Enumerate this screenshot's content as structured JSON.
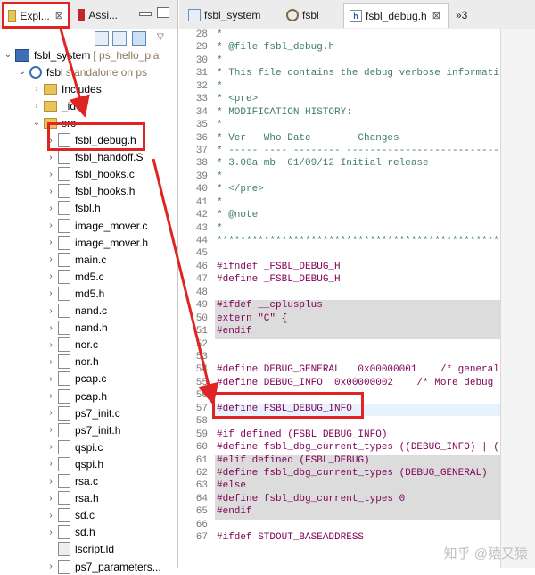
{
  "explorer": {
    "tabs": [
      {
        "label": "Expl...",
        "close": "⊠"
      },
      {
        "label": "Assi..."
      }
    ],
    "toolbar_icons": [
      "collapse-all-icon",
      "link-editor-icon",
      "filter-icon",
      "view-menu-icon"
    ],
    "tree": [
      {
        "label": "fsbl_system",
        "desc": "[ ps_hello_pla",
        "level": 0,
        "expanded": true,
        "icon": "project"
      },
      {
        "label": "fsbl",
        "desc": "standalone on ps",
        "level": 1,
        "expanded": true,
        "icon": "gear"
      },
      {
        "label": "Includes",
        "level": 2,
        "expanded": false,
        "icon": "folder"
      },
      {
        "label": "_ide",
        "level": 2,
        "expanded": false,
        "icon": "folder"
      },
      {
        "label": "src",
        "level": 2,
        "expanded": true,
        "icon": "folder"
      },
      {
        "label": "fsbl_debug.h",
        "level": 3,
        "icon": "h"
      },
      {
        "label": "fsbl_handoff.S",
        "level": 3,
        "icon": "S"
      },
      {
        "label": "fsbl_hooks.c",
        "level": 3,
        "icon": "c"
      },
      {
        "label": "fsbl_hooks.h",
        "level": 3,
        "icon": "h"
      },
      {
        "label": "fsbl.h",
        "level": 3,
        "icon": "h"
      },
      {
        "label": "image_mover.c",
        "level": 3,
        "icon": "c"
      },
      {
        "label": "image_mover.h",
        "level": 3,
        "icon": "h"
      },
      {
        "label": "main.c",
        "level": 3,
        "icon": "c"
      },
      {
        "label": "md5.c",
        "level": 3,
        "icon": "c"
      },
      {
        "label": "md5.h",
        "level": 3,
        "icon": "h"
      },
      {
        "label": "nand.c",
        "level": 3,
        "icon": "c"
      },
      {
        "label": "nand.h",
        "level": 3,
        "icon": "h"
      },
      {
        "label": "nor.c",
        "level": 3,
        "icon": "c"
      },
      {
        "label": "nor.h",
        "level": 3,
        "icon": "h"
      },
      {
        "label": "pcap.c",
        "level": 3,
        "icon": "c"
      },
      {
        "label": "pcap.h",
        "level": 3,
        "icon": "h"
      },
      {
        "label": "ps7_init.c",
        "level": 3,
        "icon": "c"
      },
      {
        "label": "ps7_init.h",
        "level": 3,
        "icon": "h"
      },
      {
        "label": "qspi.c",
        "level": 3,
        "icon": "c"
      },
      {
        "label": "qspi.h",
        "level": 3,
        "icon": "h"
      },
      {
        "label": "rsa.c",
        "level": 3,
        "icon": "c"
      },
      {
        "label": "rsa.h",
        "level": 3,
        "icon": "h"
      },
      {
        "label": "sd.c",
        "level": 3,
        "icon": "c"
      },
      {
        "label": "sd.h",
        "level": 3,
        "icon": "h"
      },
      {
        "label": "lscript.ld",
        "level": 3,
        "icon": "ld",
        "noarrow": true
      },
      {
        "label": "ps7_parameters...",
        "level": 3,
        "icon": "h"
      }
    ]
  },
  "editor": {
    "tabs": [
      {
        "label": "fsbl_system"
      },
      {
        "label": "fsbl"
      },
      {
        "label": "fsbl_debug.h",
        "close": "⊠"
      },
      {
        "label": "»3"
      }
    ],
    "lines": [
      {
        "n": "28",
        "t": "*",
        "kind": "comment"
      },
      {
        "n": "29",
        "t": "* @file fsbl_debug.h",
        "kind": "comment"
      },
      {
        "n": "30",
        "t": "*",
        "kind": "comment"
      },
      {
        "n": "31",
        "t": "* This file contains the debug verbose informati",
        "kind": "comment"
      },
      {
        "n": "32",
        "t": "*",
        "kind": "comment"
      },
      {
        "n": "33",
        "t": "* <pre>",
        "kind": "comment"
      },
      {
        "n": "34",
        "t": "* MODIFICATION HISTORY:",
        "kind": "comment"
      },
      {
        "n": "35",
        "t": "*",
        "kind": "comment"
      },
      {
        "n": "36",
        "t": "* Ver   Who Date        Changes",
        "kind": "comment"
      },
      {
        "n": "37",
        "t": "* ----- ---- -------- ------------------------------",
        "kind": "comment"
      },
      {
        "n": "38",
        "t": "* 3.00a mb  01/09/12 Initial release",
        "kind": "comment"
      },
      {
        "n": "39",
        "t": "*",
        "kind": "comment"
      },
      {
        "n": "40",
        "t": "* </pre>",
        "kind": "comment"
      },
      {
        "n": "41",
        "t": "*",
        "kind": "comment"
      },
      {
        "n": "42",
        "t": "* @note",
        "kind": "comment"
      },
      {
        "n": "43",
        "t": "*",
        "kind": "comment"
      },
      {
        "n": "44",
        "t": "**************************************************",
        "kind": "comment"
      },
      {
        "n": "45",
        "t": "",
        "kind": "code"
      },
      {
        "n": "46",
        "t": "#ifndef _FSBL_DEBUG_H",
        "kind": "pp"
      },
      {
        "n": "47",
        "t": "#define _FSBL_DEBUG_H",
        "kind": "pp"
      },
      {
        "n": "48",
        "t": "",
        "kind": "code"
      },
      {
        "n": "49",
        "t": "#ifdef __cplusplus",
        "kind": "pp",
        "shade": true
      },
      {
        "n": "50",
        "t": "extern \"C\" {",
        "kind": "pp",
        "shade": true
      },
      {
        "n": "51",
        "t": "#endif",
        "kind": "pp",
        "shade": true
      },
      {
        "n": "52",
        "t": "",
        "kind": "code"
      },
      {
        "n": "53",
        "t": "",
        "kind": "code"
      },
      {
        "n": "54",
        "t": "#define DEBUG_GENERAL   0x00000001    /* general",
        "kind": "pp"
      },
      {
        "n": "55",
        "t": "#define DEBUG_INFO  0x00000002    /* More debug",
        "kind": "pp"
      },
      {
        "n": "56",
        "t": "",
        "kind": "code"
      },
      {
        "n": "57",
        "t": "#define FSBL_DEBUG_INFO",
        "kind": "pp",
        "current": true
      },
      {
        "n": "58",
        "t": "",
        "kind": "code"
      },
      {
        "n": "59",
        "t": "#if defined (FSBL_DEBUG_INFO)",
        "kind": "pp"
      },
      {
        "n": "60",
        "t": "#define fsbl_dbg_current_types ((DEBUG_INFO) | (",
        "kind": "pp"
      },
      {
        "n": "61",
        "t": "#elif defined (FSBL_DEBUG)",
        "kind": "pp",
        "shade": true
      },
      {
        "n": "62",
        "t": "#define fsbl_dbg_current_types (DEBUG_GENERAL)",
        "kind": "pp",
        "shade": true
      },
      {
        "n": "63",
        "t": "#else",
        "kind": "pp",
        "shade": true
      },
      {
        "n": "64",
        "t": "#define fsbl_dbg_current_types 0",
        "kind": "pp",
        "shade": true
      },
      {
        "n": "65",
        "t": "#endif",
        "kind": "pp",
        "shade": true
      },
      {
        "n": "66",
        "t": "",
        "kind": "code"
      },
      {
        "n": "67",
        "t": "#ifdef STDOUT_BASEADDRESS",
        "kind": "pp"
      }
    ]
  },
  "watermark": "知乎 @猿又猿",
  "colors": {
    "highlight": "#e02424",
    "comment": "#3f7f5f",
    "keyword": "#7f0055",
    "shade": "#dcdcdc"
  }
}
